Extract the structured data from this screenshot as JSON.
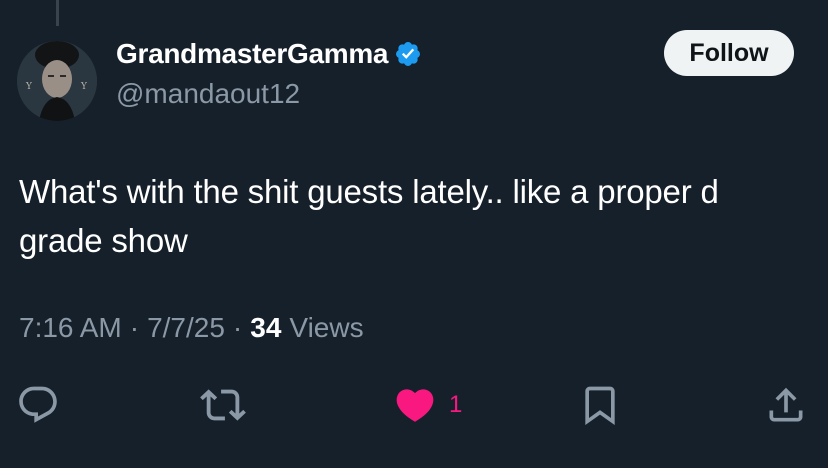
{
  "tweet": {
    "author": {
      "display_name": "GrandmasterGamma",
      "handle": "@mandaout12",
      "verified_icon": "verified-badge-icon",
      "avatar_icon": "profile-photo"
    },
    "follow_label": "Follow",
    "text": "What's with the shit guests lately.. like a proper d grade show",
    "time": "7:16 AM",
    "date": "7/7/25",
    "separator": "·",
    "views_count": "34",
    "views_label": "Views",
    "actions": {
      "reply_icon": "reply-icon",
      "retweet_icon": "retweet-icon",
      "like_icon": "heart-icon",
      "like_count": "1",
      "bookmark_icon": "bookmark-icon",
      "share_icon": "share-icon"
    }
  },
  "colors": {
    "background": "#15202b",
    "primary_text": "#ffffff",
    "secondary_text": "#8b98a5",
    "verified_blue": "#1d9bf0",
    "like_pink": "#f91880",
    "follow_button_bg": "#eff3f4",
    "icon_gray": "#8b98a5"
  }
}
